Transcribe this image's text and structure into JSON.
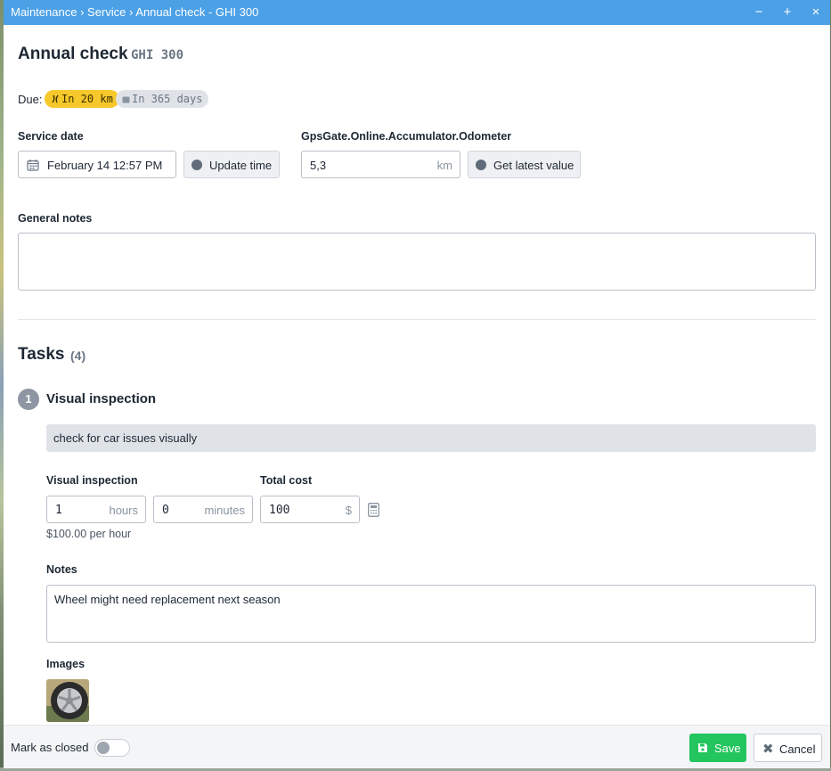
{
  "window": {
    "breadcrumb": [
      "Maintenance",
      "Service",
      "Annual check - GHI 300"
    ],
    "separator": "›",
    "controls": {
      "minimize": "−",
      "maximize": "+",
      "close": "×"
    }
  },
  "header": {
    "title": "Annual check",
    "subtitle": "GHI 300"
  },
  "due": {
    "label": "Due:",
    "distance_badge": "In 20 km",
    "days_badge": "In 365 days",
    "colors": {
      "distance": "#f7c82b",
      "days": "#dfe3e8"
    }
  },
  "service_date": {
    "label": "Service date",
    "value": "February 14 12:57 PM",
    "update_button": "Update time",
    "icons": {
      "field": "calendar-icon",
      "button": "clock-icon"
    }
  },
  "odometer": {
    "label": "GpsGate.Online.Accumulator.Odometer",
    "value": "5,3",
    "unit": "km",
    "button": "Get latest value",
    "icon": "gauge-icon"
  },
  "general_notes": {
    "label": "General notes",
    "value": ""
  },
  "tasks": {
    "title": "Tasks",
    "count": "(4)",
    "items": [
      {
        "number": "1",
        "name": "Visual inspection",
        "description": "check for car issues visually",
        "time_label": "Visual inspection",
        "hours_value": "1",
        "hours_unit": "hours",
        "minutes_value": "0",
        "minutes_unit": "minutes",
        "cost_label": "Total cost",
        "cost_value": "100",
        "cost_unit": "$",
        "rate_text": "$100.00 per hour",
        "notes_label": "Notes",
        "notes_value": "Wheel might need replacement next season",
        "images_label": "Images",
        "image_icon": "calculator-icon"
      }
    ]
  },
  "footer": {
    "mark_closed_label": "Mark as closed",
    "mark_closed_value": false,
    "save_label": "Save",
    "cancel_label": "Cancel",
    "colors": {
      "save": "#22c55e",
      "titlebar": "#4ba0e6"
    }
  }
}
